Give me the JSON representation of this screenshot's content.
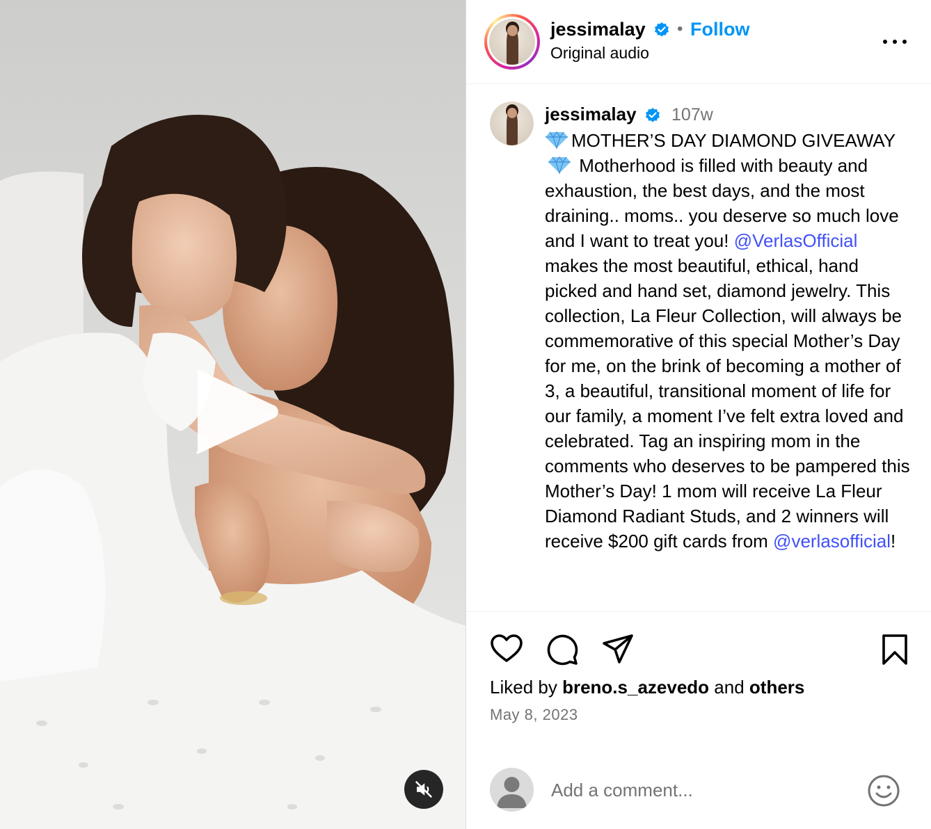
{
  "header": {
    "username": "jessimalay",
    "separator": "•",
    "follow_label": "Follow",
    "audio_label": "Original audio"
  },
  "caption": {
    "username": "jessimalay",
    "time_ago": "107w",
    "part1": "MOTHER’S DAY DIAMOND GIVEAWAY",
    "part2": "Motherhood is filled with beauty and exhaustion, the best days, and the most draining.. moms.. you deserve so much love and I want to treat you!",
    "mention1": "@VerlasOfficial",
    "part3": "makes the most beautiful, ethical, hand picked and hand set, diamond jewelry. This collection, La Fleur Collection, will always be commemorative of this special Mother’s Day for me, on the brink of becoming a mother of 3, a beautiful, transitional moment of life for our family, a moment I’ve felt extra loved and celebrated. Tag an inspiring mom in the comments who deserves to be pampered this Mother’s Day! 1 mom will receive La Fleur Diamond Radiant Studs, and 2 winners will receive $200 gift cards from",
    "mention2": "@verlasofficial",
    "part4": "!"
  },
  "likes": {
    "prefix": "Liked by",
    "user": "breno.s_azevedo",
    "and": "and",
    "others": "others"
  },
  "post_date": "May 8, 2023",
  "comment": {
    "placeholder": "Add a comment..."
  },
  "icons": {
    "header_more": "more-horizontal-icon",
    "verified": "verified-badge-icon",
    "play": "play-icon",
    "mute": "speaker-muted-icon",
    "like": "heart-icon",
    "comment": "comment-bubble-icon",
    "share": "paper-plane-icon",
    "save": "bookmark-icon",
    "emoji": "smiley-face-icon",
    "caption_emoji": "gem-stone-icon"
  },
  "colors": {
    "follow": "#0095f6",
    "mention": "#4150f7",
    "verified": "#0095f6",
    "secondary_text": "#737373"
  }
}
